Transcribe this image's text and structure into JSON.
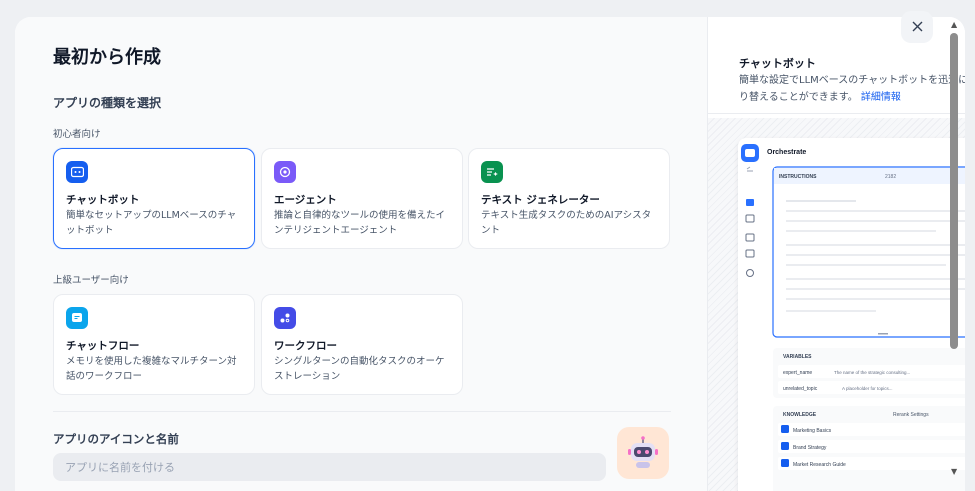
{
  "header": {
    "title": "最初から作成"
  },
  "app_type": {
    "section_label": "アプリの種類を選択",
    "beginner_label": "初心者向け",
    "advanced_label": "上級ユーザー向け",
    "beginner_cards": [
      {
        "title": "チャットボット",
        "desc": "簡単なセットアップのLLMベースのチャットボット",
        "icon": "chat-bot-icon",
        "color": "#155eef"
      },
      {
        "title": "エージェント",
        "desc": "推論と自律的なツールの使用を備えたインテリジェントエージェント",
        "icon": "agent-icon",
        "color": "#7a5af8"
      },
      {
        "title": "テキスト ジェネレーター",
        "desc": "テキスト生成タスクのためのAIアシスタント",
        "icon": "text-generator-icon",
        "color": "#099250"
      }
    ],
    "advanced_cards": [
      {
        "title": "チャットフロー",
        "desc": "メモリを使用した複雑なマルチターン対話のワークフロー",
        "icon": "chatflow-icon",
        "color": "#0ba5ec"
      },
      {
        "title": "ワークフロー",
        "desc": "シングルターンの自動化タスクのオーケストレーション",
        "icon": "workflow-icon",
        "color": "#444ce7"
      }
    ]
  },
  "app_name": {
    "label": "アプリのアイコンと名前",
    "placeholder": "アプリに名前を付ける",
    "icon": "robot-avatar-icon"
  },
  "preview": {
    "title": "チャットボット",
    "desc_line1": "簡単な設定でLLMベースのチャットボットを迅速に",
    "desc_line2": "り替えることができます。",
    "link": "詳細情報",
    "orchestrate": "Orchestrate",
    "instructions": "INSTRUCTIONS",
    "char_count": "2182",
    "variables_label": "VARIABLES",
    "variables": [
      {
        "name": "expert_name",
        "desc": "The name of the strategic consulting..."
      },
      {
        "name": "unrelated_topic",
        "desc": "A placeholder for topics..."
      }
    ],
    "knowledge_label": "KNOWLEDGE",
    "rerank": "Rerank Settings",
    "knowledge": [
      "Marketing Basics",
      "Brand Strategy",
      "Market Research Guide"
    ]
  },
  "colors": {
    "accent": "#2970ff",
    "avatar_bg": "#ffe6d5"
  }
}
